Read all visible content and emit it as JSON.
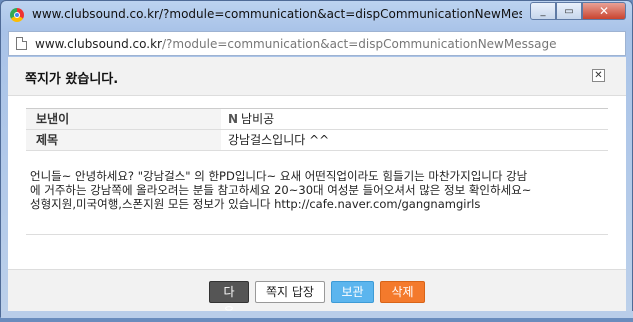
{
  "window": {
    "title": "www.clubsound.co.kr/?module=communication&act=dispCommunicationNewMessage - ...",
    "controls": {
      "minimize": "_",
      "maximize": "▭",
      "close": "✕"
    }
  },
  "addressbar": {
    "host": "www.clubsound.co.kr",
    "path": "/?module=communication&act=dispCommunicationNewMessage"
  },
  "dialog": {
    "title": "쪽지가 왔습니다.",
    "close_label": "✕",
    "sender_label": "보낸이",
    "sender_badge": "N",
    "sender_value": "남비공",
    "subject_label": "제목",
    "subject_value": "강남걸스입니다 ^^",
    "message": "언니들~ 안녕하세요? \"강남걸스\" 의 한PD입니다~ 요새 어떤직업이라도 힘들기는 마찬가지입니다 강남\n에 거주하는 강남쪽에 올라오려는 분들 참고하세요 20~30대 여성분 들어오셔서 많은 정보 확인하세요~\n성형지원,미국여행,스폰지원 모든 정보가 있습니다 http://cafe.naver.com/gangnamgirls"
  },
  "buttons": {
    "next": "다음",
    "reply": "쪽지 답장",
    "save": "보관",
    "delete": "삭제"
  }
}
